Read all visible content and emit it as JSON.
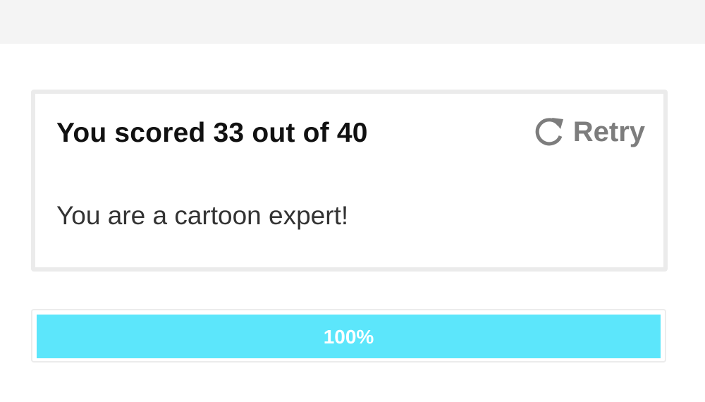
{
  "colors": {
    "top_bar": "#f4f4f4",
    "card_border": "#ebebeb",
    "progress_fill": "#5ce6fb",
    "retry": "#7d7d7d"
  },
  "result": {
    "score_text": "You scored 33 out of 40",
    "message": "You are a cartoon expert!"
  },
  "retry": {
    "icon": "refresh-icon",
    "label": "Retry"
  },
  "progress": {
    "value_percent": 100,
    "label": "100%"
  }
}
